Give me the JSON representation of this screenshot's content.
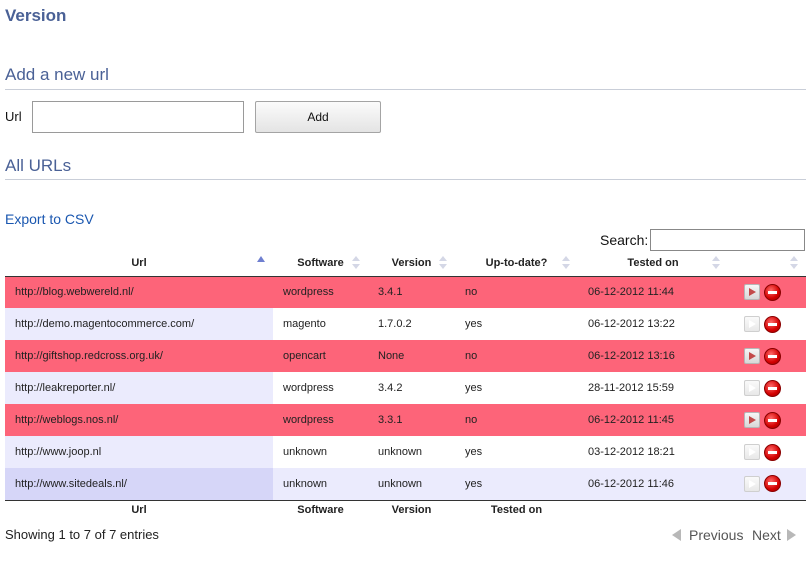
{
  "page": {
    "title": "Version"
  },
  "add_section": {
    "heading": "Add a new url",
    "url_label": "Url",
    "url_value": "",
    "add_label": "Add"
  },
  "list_section": {
    "heading": "All URLs",
    "export_label": "Export to CSV",
    "search_label": "Search:",
    "search_value": ""
  },
  "table": {
    "headers": [
      "Url",
      "Software",
      "Version",
      "Up-to-date?",
      "Tested on"
    ],
    "footer": [
      "Url",
      "Software",
      "Version",
      "Tested on"
    ],
    "sorted_column": "Url",
    "rows": [
      {
        "url": "http://blog.webwereld.nl/",
        "software": "wordpress",
        "version": "3.4.1",
        "uptodate": "no",
        "tested_on": "06-12-2012 11:44"
      },
      {
        "url": "http://demo.magentocommerce.com/",
        "software": "magento",
        "version": "1.7.0.2",
        "uptodate": "yes",
        "tested_on": "06-12-2012 13:22"
      },
      {
        "url": "http://giftshop.redcross.org.uk/",
        "software": "opencart",
        "version": "None",
        "uptodate": "no",
        "tested_on": "06-12-2012 13:16"
      },
      {
        "url": "http://leakreporter.nl/",
        "software": "wordpress",
        "version": "3.4.2",
        "uptodate": "yes",
        "tested_on": "28-11-2012 15:59"
      },
      {
        "url": "http://weblogs.nos.nl/",
        "software": "wordpress",
        "version": "3.3.1",
        "uptodate": "no",
        "tested_on": "06-12-2012 11:45"
      },
      {
        "url": "http://www.joop.nl",
        "software": "unknown",
        "version": "unknown",
        "uptodate": "yes",
        "tested_on": "03-12-2012 18:21"
      },
      {
        "url": "http://www.sitedeals.nl/",
        "software": "unknown",
        "version": "unknown",
        "uptodate": "yes",
        "tested_on": "06-12-2012 11:46"
      }
    ]
  },
  "pagination": {
    "info": "Showing 1 to 7 of 7 entries",
    "previous_label": "Previous",
    "next_label": "Next"
  },
  "icons": {
    "run": "play-icon",
    "delete": "delete-icon",
    "previous": "arrow-left-icon",
    "next": "arrow-right-icon"
  },
  "colors": {
    "heading": "#4a6196",
    "outdated_row": "#fd6479",
    "link": "#1a57b0"
  }
}
